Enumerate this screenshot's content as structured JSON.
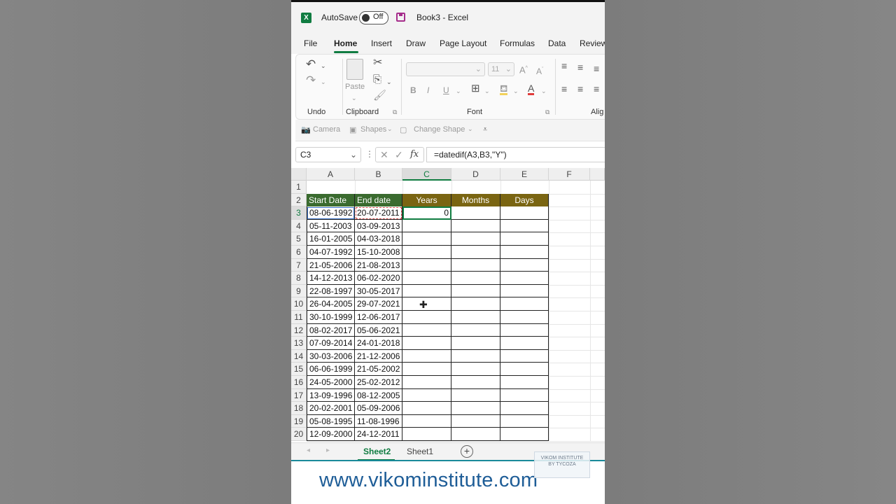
{
  "window": {
    "autosave_label": "AutoSave",
    "autosave_state": "Off",
    "doc_title": "Book3  -  Excel"
  },
  "ribbon_tabs": [
    "File",
    "Home",
    "Insert",
    "Draw",
    "Page Layout",
    "Formulas",
    "Data",
    "Review"
  ],
  "ribbon": {
    "undo_label": "Undo",
    "clipboard_label": "Clipboard",
    "paste_label": "Paste",
    "font_label": "Font",
    "font_size": "11",
    "align_label": "Alig"
  },
  "quick_bar": {
    "camera": "Camera",
    "shapes": "Shapes",
    "change_shape": "Change Shape"
  },
  "formula_bar": {
    "name_box": "C3",
    "fx": "fx",
    "formula": "=datedif(A3,B3,\"Y\")"
  },
  "columns": [
    "A",
    "B",
    "C",
    "D",
    "E",
    "F"
  ],
  "rows": [
    "1",
    "2",
    "3",
    "4",
    "5",
    "6",
    "7",
    "8",
    "9",
    "10",
    "11",
    "12",
    "13",
    "14",
    "15",
    "16",
    "17",
    "18",
    "19",
    "20"
  ],
  "headers": {
    "start_date": "Start Date",
    "end_date": "End date",
    "years": "Years",
    "months": "Months",
    "days": "Days"
  },
  "data": [
    {
      "start": "08-06-1992",
      "end": "20-07-2011",
      "years": "0"
    },
    {
      "start": "05-11-2003",
      "end": "03-09-2013"
    },
    {
      "start": "16-01-2005",
      "end": "04-03-2018"
    },
    {
      "start": "04-07-1992",
      "end": "15-10-2008"
    },
    {
      "start": "21-05-2006",
      "end": "21-08-2013"
    },
    {
      "start": "14-12-2013",
      "end": "06-02-2020"
    },
    {
      "start": "22-08-1997",
      "end": "30-05-2017"
    },
    {
      "start": "26-04-2005",
      "end": "29-07-2021"
    },
    {
      "start": "30-10-1999",
      "end": "12-06-2017"
    },
    {
      "start": "08-02-2017",
      "end": "05-06-2021"
    },
    {
      "start": "07-09-2014",
      "end": "24-01-2018"
    },
    {
      "start": "30-03-2006",
      "end": "21-12-2006"
    },
    {
      "start": "06-06-1999",
      "end": "21-05-2002"
    },
    {
      "start": "24-05-2000",
      "end": "25-02-2012"
    },
    {
      "start": "13-09-1996",
      "end": "08-12-2005"
    },
    {
      "start": "20-02-2001",
      "end": "05-09-2006"
    },
    {
      "start": "05-08-1995",
      "end": "11-08-1996"
    },
    {
      "start": "12-09-2000",
      "end": "24-12-2011"
    }
  ],
  "sheets": [
    "Sheet2",
    "Sheet1"
  ],
  "footer": {
    "url": "www.vikominstitute.com",
    "watermark_line1": "VIKOM INSTITUTE",
    "watermark_line2": "BY TYCOZA"
  },
  "colors": {
    "header_green": "#3a6b2f",
    "header_olive": "#7a6512",
    "excel_green": "#107c41"
  }
}
